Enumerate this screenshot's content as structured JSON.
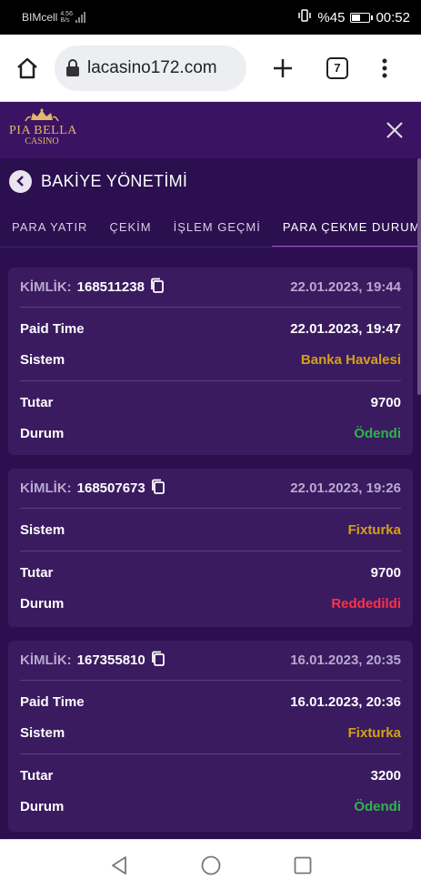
{
  "status_bar": {
    "carrier": "BIMcell",
    "net_speed": "4.56",
    "net_unit": "B/s",
    "battery": "%45",
    "time": "00:52"
  },
  "browser": {
    "url": "lacasino172.com",
    "tab_count": "7"
  },
  "site": {
    "logo_name": "PIA BELLA",
    "logo_sub": "CASINO"
  },
  "page": {
    "title": "BAKİYE YÖNETİMİ"
  },
  "tabs": [
    {
      "label": "PARA YATIR"
    },
    {
      "label": "ÇEKİM"
    },
    {
      "label": "İŞLEM GEÇMİ"
    },
    {
      "label": "PARA ÇEKME DURUMU"
    }
  ],
  "labels": {
    "id": "KİMLİK:",
    "paid_time": "Paid Time",
    "system": "Sistem",
    "amount": "Tutar",
    "status": "Durum"
  },
  "withdrawals": [
    {
      "id": "168511238",
      "date": "22.01.2023, 19:44",
      "paid_time": "22.01.2023, 19:47",
      "system": "Banka Havalesi",
      "amount": "9700",
      "status": "Ödendi"
    },
    {
      "id": "168507673",
      "date": "22.01.2023, 19:26",
      "system": "Fixturka",
      "amount": "9700",
      "status": "Reddedildi"
    },
    {
      "id": "167355810",
      "date": "16.01.2023, 20:35",
      "paid_time": "16.01.2023, 20:36",
      "system": "Fixturka",
      "amount": "3200",
      "status": "Ödendi"
    }
  ],
  "colors": {
    "system": "#d4a017",
    "status_paid": "#2fb34a",
    "status_rejected": "#ff3048",
    "accent": "#a84bd6"
  }
}
